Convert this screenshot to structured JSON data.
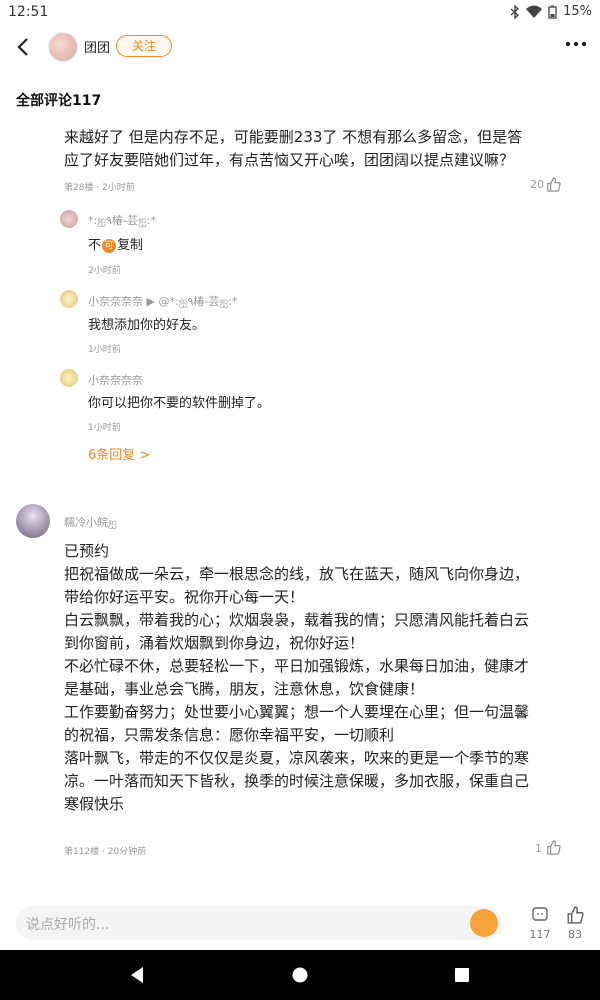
{
  "status_bar": {
    "time": "12:51",
    "battery": "15%"
  },
  "header": {
    "author_name": "团团",
    "follow_label": "关注"
  },
  "comments_header": {
    "title": "全部评论117"
  },
  "comment1": {
    "text_line1": "来越好了  但是内存不足，可能要删233了 不想有那么多留念，但是答",
    "text_line2": "应了好友要陪她们过年，有点苦恼又开心唉，团团阔以提点建议嘛？",
    "meta": "第28楼 · 2小时前",
    "likes": "20",
    "replies": [
      {
        "name": "*:ஐ٩椿-芸ஐ:*",
        "text_before": "不",
        "badge": "可",
        "text_after": "复制",
        "time": "2小时前"
      },
      {
        "name": "小奈奈奈奈 ▶ @*:ஐ٩椿-芸ஐ:*",
        "text": "我想添加你的好友。",
        "time": "1小时前"
      },
      {
        "name": "小奈奈奈奈",
        "text": "你可以把你不要的软件删掉了。",
        "time": "1小时前"
      }
    ],
    "more_replies": "6条回复 >"
  },
  "comment2": {
    "user": "糯冷小皖ஐ",
    "lines": [
      "已预约",
      "把祝福做成一朵云，牵一根思念的线，放飞在蓝天，随风飞向你身边，",
      "带给你好运平安。祝你开心每一天！",
      "白云飘飘，带着我的心；炊烟袅袅，载着我的情；只愿清风能托着白云",
      "到你窗前，涌着炊烟飘到你身边，祝你好运！",
      "不必忙碌不休，总要轻松一下，平日加强锻炼，水果每日加油，健康才",
      "是基础，事业总会飞腾，朋友，注意休息，饮食健康！",
      "工作要勤奋努力；处世要小心翼翼；想一个人要埋在心里；但一句温馨",
      "的祝福，只需发条信息：愿你幸福平安，一切顺利",
      "落叶飘飞，带走的不仅仅是炎夏，凉风袭来，吹来的更是一个季节的寒",
      "凉。一叶落而知天下皆秋，换季的时候注意保暖，多加衣服，保重自己",
      "寒假快乐"
    ],
    "meta": "第112楼 · 20分钟前",
    "likes": "1"
  },
  "bottom_bar": {
    "placeholder": "说点好听的...",
    "comment_count": "117",
    "like_count": "83"
  },
  "icons": [
    "back-arrow-icon",
    "more-icon",
    "thumb-up-icon",
    "comment-icon",
    "emoji-icon",
    "bluetooth-icon",
    "wifi-icon",
    "battery-icon"
  ],
  "colors": {
    "accent": "#f08a24",
    "meta_text": "#999999"
  }
}
